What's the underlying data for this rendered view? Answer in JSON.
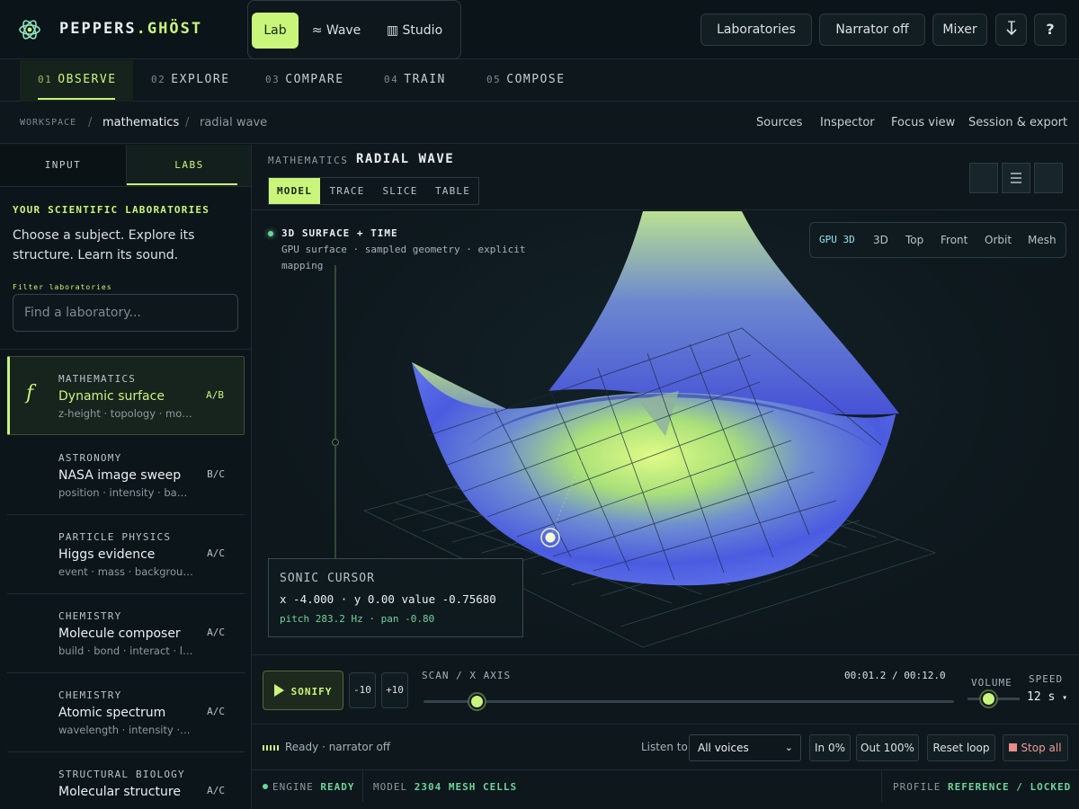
{
  "app": {
    "brand_prefix": "PEPPERS",
    "brand_suffix": "GHÖST",
    "modes": [
      "Lab",
      "≈ Wave",
      "▥ Studio"
    ],
    "top_buttons": [
      "Laboratories",
      "Narrator off",
      "Mixer"
    ],
    "download_icon": "download-icon",
    "help_label": "?"
  },
  "steps": [
    {
      "num": "01",
      "label": "OBSERVE"
    },
    {
      "num": "02",
      "label": "EXPLORE"
    },
    {
      "num": "03",
      "label": "COMPARE"
    },
    {
      "num": "04",
      "label": "TRAIN"
    },
    {
      "num": "05",
      "label": "COMPOSE"
    }
  ],
  "breadcrumb": {
    "workspace": "WORKSPACE",
    "sep": "/",
    "current": "mathematics",
    "sub": "radial wave",
    "links": [
      "Sources",
      "Inspector",
      "Focus view",
      "Session & export"
    ]
  },
  "sidebar": {
    "tabs": [
      "INPUT",
      "LABS"
    ],
    "heading": "YOUR SCIENTIFIC LABORATORIES",
    "description": "Choose a subject. Explore its structure. Learn its sound.",
    "filter_label": "Filter laboratories",
    "filter_placeholder": "Find a laboratory...",
    "labs": [
      {
        "category": "MATHEMATICS",
        "title": "Dynamic surface",
        "sub": "z-height · topology · motion",
        "tag": "A/B",
        "glyph": "f"
      },
      {
        "category": "ASTRONOMY",
        "title": "NASA image sweep",
        "sub": "position · intensity · bands",
        "tag": "B/C"
      },
      {
        "category": "PARTICLE PHYSICS",
        "title": "Higgs evidence",
        "sub": "event · mass · background",
        "tag": "A/C"
      },
      {
        "category": "CHEMISTRY",
        "title": "Molecule composer",
        "sub": "build · bond · interact · listen",
        "tag": "A/C"
      },
      {
        "category": "CHEMISTRY",
        "title": "Atomic spectrum",
        "sub": "wavelength · intensity · lines",
        "tag": "A/C"
      },
      {
        "category": "STRUCTURAL BIOLOGY",
        "title": "Molecular structure",
        "sub": "",
        "tag": "A/C"
      }
    ]
  },
  "panel": {
    "category": "MATHEMATICS",
    "title": "RADIAL WAVE",
    "view_tabs": [
      "MODEL",
      "TRACE",
      "SLICE",
      "TABLE"
    ],
    "viewport_title": "3D SURFACE + TIME",
    "viewport_sub": "GPU surface · sampled geometry · explicit mapping",
    "camera": [
      "GPU 3D",
      "3D",
      "Top",
      "Front",
      "Orbit",
      "Mesh"
    ]
  },
  "cursor": {
    "label": "SONIC CURSOR",
    "coords": "x -4.000 · y 0.00 value -0.75680",
    "audio": "pitch 283.2 Hz · pan -0.80"
  },
  "transport": {
    "sonify": "SONIFY",
    "back": "-10",
    "fwd": "+10",
    "scan_label": "SCAN / X AXIS",
    "time": "00:01.2 / 00:12.0",
    "scan_progress": 0.1,
    "volume_label": "VOLUME",
    "speed_label": "SPEED",
    "speed_value": "12 s"
  },
  "listen": {
    "status": "Ready · narrator off",
    "label": "Listen to",
    "voice": "All voices",
    "fade_in": "In 0%",
    "fade_out": "Out 100%",
    "reset": "Reset loop",
    "stop": "Stop all"
  },
  "status": {
    "engine_label": "ENGINE",
    "engine_value": "READY",
    "model_label": "MODEL",
    "model_value": "2304 MESH CELLS",
    "profile_label": "PROFILE",
    "profile_value": "REFERENCE / LOCKED"
  },
  "colors": {
    "accent": "#c9f57a",
    "surface_blue": "#4f5fe0",
    "surface_green": "#d8f77a",
    "status_green": "#6fd39a"
  }
}
